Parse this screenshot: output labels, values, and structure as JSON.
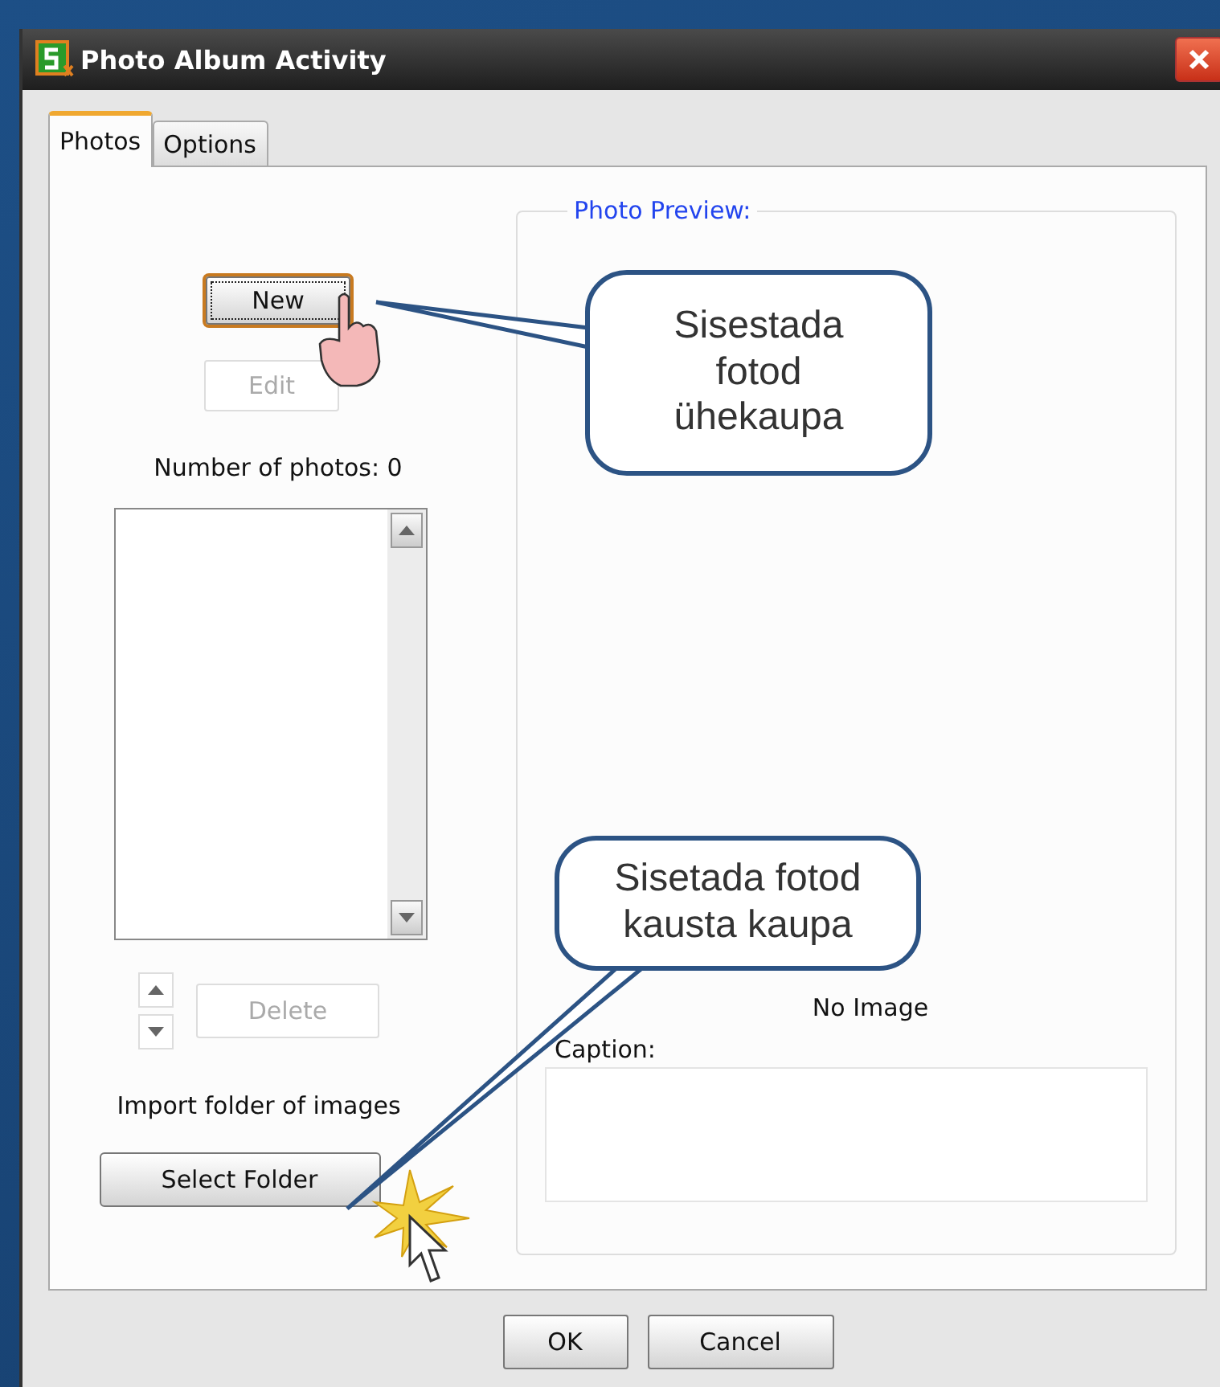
{
  "window": {
    "title": "Photo Album Activity"
  },
  "tabs": [
    {
      "label": "Photos",
      "selected": true
    },
    {
      "label": "Options",
      "selected": false
    }
  ],
  "photos_panel": {
    "new_button": {
      "label": "New",
      "focused": true
    },
    "edit_button": {
      "label": "Edit",
      "disabled": true
    },
    "count_label": "Number of photos: 0",
    "delete_button": {
      "label": "Delete",
      "disabled": true
    },
    "import_label": "Import folder of images",
    "select_folder_button": {
      "label": "Select Folder"
    }
  },
  "preview": {
    "legend": "Photo Preview:",
    "image_text": "No Image",
    "caption_label": "Caption:"
  },
  "callouts": [
    {
      "text": "Sisestada fotod ühekaupa"
    },
    {
      "text": "Sisetada fotod kausta kaupa"
    }
  ],
  "buttons": [
    "OK",
    "Cancel"
  ]
}
